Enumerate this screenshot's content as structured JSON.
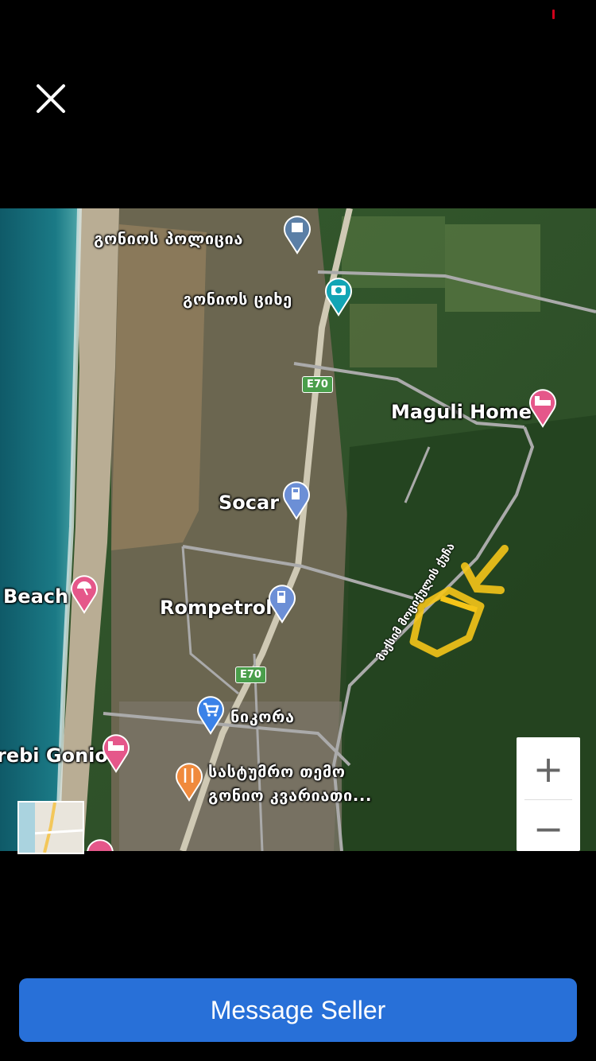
{
  "close_icon": "close-icon",
  "map": {
    "places": [
      {
        "name": "გონიოს პოლიცია",
        "icon": "police-icon",
        "color": "#5b7fa6"
      },
      {
        "name": "გონიოს ციხე",
        "icon": "camera-icon",
        "color": "#12a5b5"
      },
      {
        "name": "Maguli Home",
        "icon": "hotel-icon",
        "color": "#e5578a"
      },
      {
        "name": "Socar",
        "icon": "fuel-icon",
        "color": "#6c8fd6"
      },
      {
        "name": "Beach",
        "icon": "beach-umbrella-icon",
        "color": "#e5578a"
      },
      {
        "name": "Rompetrol",
        "icon": "fuel-icon",
        "color": "#6c8fd6"
      },
      {
        "name": "ნიკორა",
        "icon": "shopping-cart-icon",
        "color": "#3b82e8"
      },
      {
        "name": "rebi Gonio",
        "icon": "hotel-icon",
        "color": "#e5578a"
      },
      {
        "name": "სასტუმრო თემო გონიო კვარიათი...",
        "line1": "სასტუმრო თემო",
        "line2": "გონიო კვარიათი...",
        "icon": "restaurant-icon",
        "color": "#f08a3c"
      }
    ],
    "road_shields": [
      "E70",
      "E70"
    ],
    "street_name": "მაქსიმ მოციქულის ქუჩა",
    "annotation_color": "#f5c518"
  },
  "zoom": {
    "in_label": "+",
    "out_label": "−"
  },
  "cta": {
    "label": "Message Seller",
    "color": "#2870d8"
  }
}
